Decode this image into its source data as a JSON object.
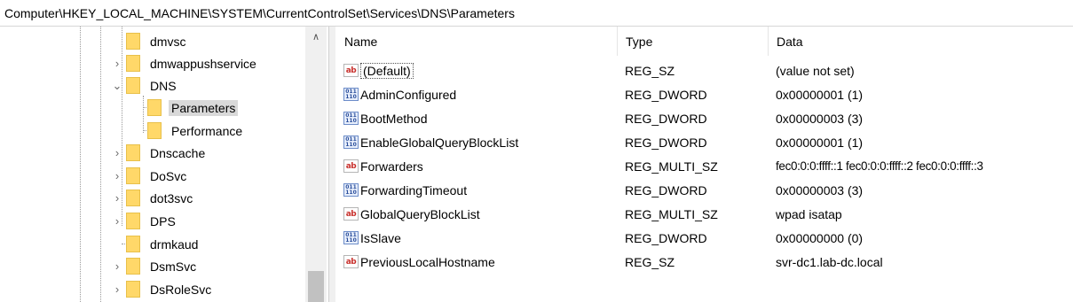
{
  "address_bar": {
    "path": "Computer\\HKEY_LOCAL_MACHINE\\SYSTEM\\CurrentControlSet\\Services\\DNS\\Parameters"
  },
  "tree": {
    "items": [
      {
        "label": "dmvsc",
        "expander": ""
      },
      {
        "label": "dmwappushservice",
        "expander": "›"
      },
      {
        "label": "DNS",
        "expander": "⌄"
      },
      {
        "label": "Parameters",
        "expander": ""
      },
      {
        "label": "Performance",
        "expander": ""
      },
      {
        "label": "Dnscache",
        "expander": "›"
      },
      {
        "label": "DoSvc",
        "expander": "›"
      },
      {
        "label": "dot3svc",
        "expander": "›"
      },
      {
        "label": "DPS",
        "expander": "›"
      },
      {
        "label": "drmkaud",
        "expander": ""
      },
      {
        "label": "DsmSvc",
        "expander": "›"
      },
      {
        "label": "DsRoleSvc",
        "expander": "›"
      }
    ],
    "scroll_up": "∧"
  },
  "columns": {
    "name": "Name",
    "type": "Type",
    "data": "Data"
  },
  "values": [
    {
      "icon": "ab",
      "name": "(Default)",
      "type": "REG_SZ",
      "data": "(value not set)"
    },
    {
      "icon": "dword",
      "name": "AdminConfigured",
      "type": "REG_DWORD",
      "data": "0x00000001 (1)"
    },
    {
      "icon": "dword",
      "name": "BootMethod",
      "type": "REG_DWORD",
      "data": "0x00000003 (3)"
    },
    {
      "icon": "dword",
      "name": "EnableGlobalQueryBlockList",
      "type": "REG_DWORD",
      "data": "0x00000001 (1)"
    },
    {
      "icon": "ab",
      "name": "Forwarders",
      "type": "REG_MULTI_SZ",
      "data": "fec0:0:0:ffff::1 fec0:0:0:ffff::2 fec0:0:0:ffff::3"
    },
    {
      "icon": "dword",
      "name": "ForwardingTimeout",
      "type": "REG_DWORD",
      "data": "0x00000003 (3)"
    },
    {
      "icon": "ab",
      "name": "GlobalQueryBlockList",
      "type": "REG_MULTI_SZ",
      "data": "wpad isatap"
    },
    {
      "icon": "dword",
      "name": "IsSlave",
      "type": "REG_DWORD",
      "data": "0x00000000 (0)"
    },
    {
      "icon": "ab",
      "name": "PreviousLocalHostname",
      "type": "REG_SZ",
      "data": "svr-dc1.lab-dc.local"
    }
  ],
  "icon_text": {
    "ab": "ab",
    "dword_top": "011",
    "dword_bottom": "110"
  }
}
